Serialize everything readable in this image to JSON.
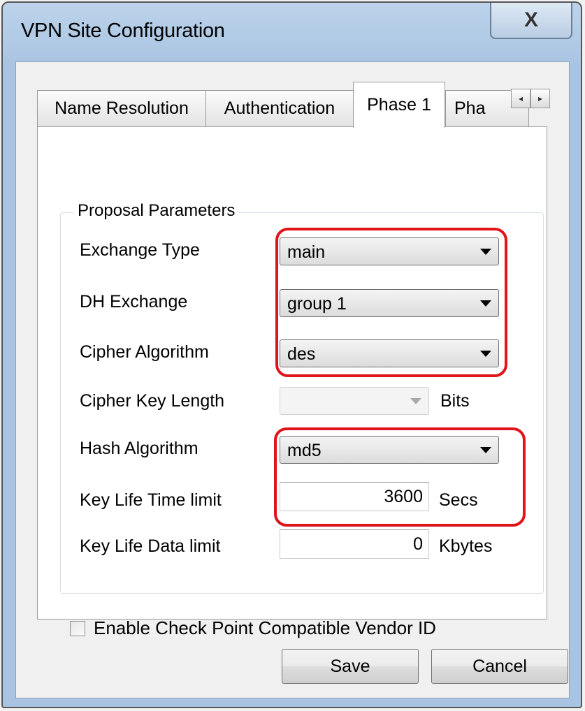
{
  "window": {
    "title": "VPN Site Configuration",
    "close_label": "X"
  },
  "tabs": [
    {
      "label": "Name Resolution",
      "active": false
    },
    {
      "label": "Authentication",
      "active": false
    },
    {
      "label": "Phase 1",
      "active": true
    },
    {
      "label": "Pha",
      "active": false
    }
  ],
  "tab_scroll": {
    "left": "◂",
    "right": "▸"
  },
  "proposal": {
    "group_title": "Proposal Parameters",
    "exchange_type": {
      "label": "Exchange Type",
      "value": "main"
    },
    "dh_exchange": {
      "label": "DH Exchange",
      "value": "group 1"
    },
    "cipher_algorithm": {
      "label": "Cipher Algorithm",
      "value": "des"
    },
    "cipher_key_length": {
      "label": "Cipher Key Length",
      "value": "",
      "unit": "Bits"
    },
    "hash_algorithm": {
      "label": "Hash Algorithm",
      "value": "md5"
    },
    "key_life_time": {
      "label": "Key Life Time limit",
      "value": "3600",
      "unit": "Secs"
    },
    "key_life_data": {
      "label": "Key Life Data limit",
      "value": "0",
      "unit": "Kbytes"
    }
  },
  "vendor_id": {
    "label": "Enable Check Point Compatible Vendor ID",
    "checked": false
  },
  "buttons": {
    "save": "Save",
    "cancel": "Cancel"
  },
  "colors": {
    "highlight": "#e0141b",
    "title_bar": "#bcd3ea"
  }
}
